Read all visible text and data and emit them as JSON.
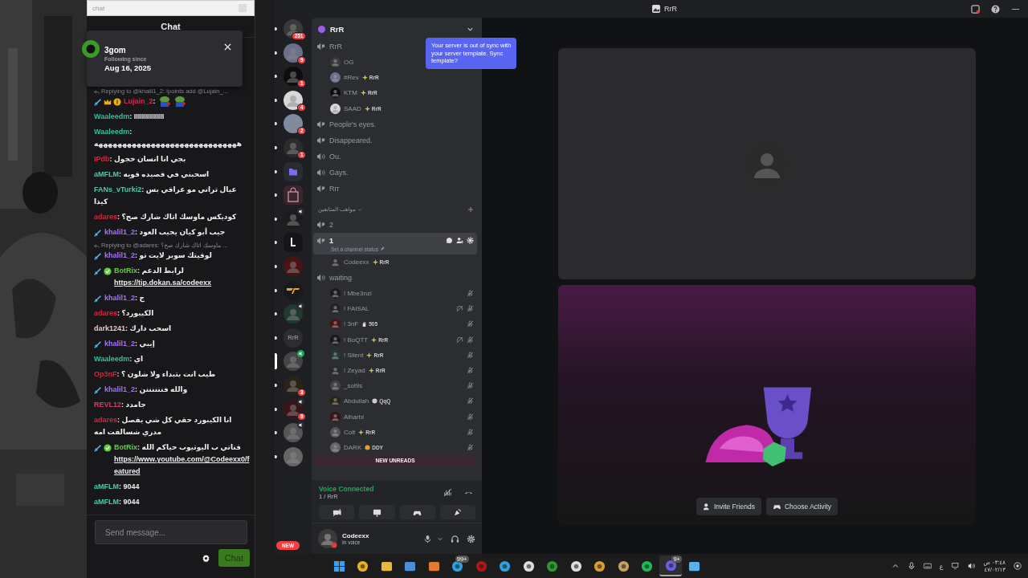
{
  "browser_field": {
    "placeholder": "chat"
  },
  "chat": {
    "title": "Chat",
    "follow_card": {
      "name": "3gom",
      "label": "Following since",
      "date": "Aug 16, 2025"
    },
    "messages": [
      {
        "reply": "Replying to @khalil1_2: !points add @Lujain_...",
        "badges": [
          {
            "kind": "sword"
          },
          {
            "kind": "crown"
          },
          {
            "kind": "coin"
          }
        ],
        "user": "Lujain_2",
        "color": "#d8284c",
        "text": ":",
        "emotes": [
          {
            "kind": "frog"
          },
          {
            "kind": "frog"
          }
        ]
      },
      {
        "user": "Waaleedm",
        "color": "#3bbf9a",
        "text": ": IIIIIIIIIIIIIII"
      },
      {
        "user": "Waaleedm",
        "color": "#3bbf9a",
        "text": ": ههههههههههههههههههههههههههههههه"
      },
      {
        "user": "IPdb",
        "color": "#d0283e",
        "text": ": بجي انا انسان خجول"
      },
      {
        "user": "aMFLM",
        "color": "#4ec9a6",
        "text": ": اسحبني في قصيده قويه"
      },
      {
        "user": "FANs_vTurki2",
        "color": "#4ec9a6",
        "text": ": عيال تراني مو عراقي بس كيذا"
      },
      {
        "user": "adares",
        "color": "#d0283e",
        "text": ": كوديكس ماوسك اتاك شارك صح؟"
      },
      {
        "badges": [
          {
            "kind": "sword"
          }
        ],
        "user": "khalil1_2",
        "color": "#a970ff",
        "text": ": جيب أبو كيان يجيب العود"
      },
      {
        "reply": "Replying to @adares: ماوسك اتاك شارك صح؟ ...",
        "badges": [
          {
            "kind": "sword"
          }
        ],
        "user": "khalil1_2",
        "color": "#a970ff",
        "text": ": لوقيتك سوبر لايت تو"
      },
      {
        "badges": [
          {
            "kind": "sword"
          },
          {
            "kind": "verified"
          }
        ],
        "user": "BotRix",
        "color": "#5ed23a",
        "text": ": لرابط الدعم ",
        "link": "https://tip.dokan.sa/codeexx"
      },
      {
        "badges": [
          {
            "kind": "sword"
          }
        ],
        "user": "khalil1_2",
        "color": "#a970ff",
        "text": ": ج"
      },
      {
        "user": "adares",
        "color": "#d0283e",
        "text": ": الكيبورد؟"
      },
      {
        "user": "dark1241",
        "color": "#e8c6cf",
        "text": ": اسحب دارك"
      },
      {
        "badges": [
          {
            "kind": "sword"
          }
        ],
        "user": "khalil1_2",
        "color": "#a970ff",
        "text": ": إيبي"
      },
      {
        "user": "Waaleedm",
        "color": "#3bbf9a",
        "text": ": اي"
      },
      {
        "user": "Op3nF",
        "color": "#d0283e",
        "text": ": طيب انت بتبداء ولا شلون ؟"
      },
      {
        "badges": [
          {
            "kind": "sword"
          }
        ],
        "user": "khalil1_2",
        "color": "#a970ff",
        "text": ": والله فننننننن"
      },
      {
        "user": "REVL12",
        "color": "#cf3f6a",
        "text": ": جامدد"
      },
      {
        "user": "adares",
        "color": "#d0283e",
        "text": ": انا الكيبورد حقي كل شي يفصل مدري شسالفت امه"
      },
      {
        "badges": [
          {
            "kind": "sword"
          },
          {
            "kind": "verified"
          }
        ],
        "user": "BotRix",
        "color": "#5ed23a",
        "text": ": قناتي ب اليوتيوب حياكم الله ",
        "link": "https://www.youtube.com/@Codeexx0/featured"
      },
      {
        "user": "aMFLM",
        "color": "#4ec9a6",
        "text": ": 9044"
      },
      {
        "user": "aMFLM",
        "color": "#4ec9a6",
        "text": ": 9044"
      }
    ],
    "input": {
      "placeholder": "Send message..."
    },
    "send_button": "Chat"
  },
  "title_bar": {
    "title": "RrR"
  },
  "rail": [
    {
      "kind": "avatar",
      "badge": "251",
      "speaker": false,
      "selected": false
    },
    {
      "kind": "avatar",
      "badge": "9",
      "speaker": false,
      "selected": false
    },
    {
      "kind": "avatar",
      "badge": "1",
      "speaker": false,
      "selected": false
    },
    {
      "kind": "avatar",
      "badge": "4",
      "speaker": false,
      "selected": false
    },
    {
      "kind": "avatar",
      "badge": "2",
      "speaker": false,
      "selected": false
    },
    {
      "kind": "avatar",
      "badge": "1",
      "speaker": false,
      "selected": false
    },
    {
      "kind": "folder",
      "speaker": false,
      "selected": false
    },
    {
      "kind": "bag",
      "speaker": false,
      "selected": false
    },
    {
      "kind": "avatar",
      "speaker": true,
      "selected": false
    },
    {
      "kind": "phone",
      "speaker": false,
      "selected": false
    },
    {
      "kind": "avatar",
      "speaker": false,
      "selected": false
    },
    {
      "kind": "logo",
      "speaker": false,
      "selected": false
    },
    {
      "kind": "avatar",
      "speaker": true,
      "selected": false
    },
    {
      "kind": "text",
      "label": "RrR",
      "speaker": false,
      "selected": false
    },
    {
      "kind": "avatar",
      "speaker": true,
      "selected": true
    },
    {
      "kind": "avatar",
      "badge": "3",
      "speaker": false,
      "selected": false
    },
    {
      "kind": "avatar",
      "badge": "9",
      "speaker": true,
      "selected": false
    },
    {
      "kind": "avatar",
      "speaker": true,
      "selected": false
    },
    {
      "kind": "avatar",
      "speaker": false,
      "selected": false
    }
  ],
  "new_pill": "NEW",
  "server": {
    "name": "RrR"
  },
  "tooltip": "Your server is out of sync with your server template. Sync template?",
  "channels": [
    {
      "kind": "stage",
      "name": "RrR",
      "selected": false,
      "members": [
        {
          "name": "OG",
          "muted": false,
          "deafened": false
        },
        {
          "name": "#Rev",
          "tag": {
            "kind": "diamond",
            "text": "RrR"
          },
          "muted": false,
          "deafened": false
        },
        {
          "name": "KTM",
          "tag": {
            "kind": "diamond",
            "text": "RrR"
          },
          "muted": false,
          "deafened": false
        },
        {
          "name": "SAAD",
          "tag": {
            "kind": "diamond",
            "text": "RrR"
          },
          "muted": false,
          "deafened": false
        }
      ]
    },
    {
      "kind": "stage",
      "name": "People's eyes.",
      "selected": false
    },
    {
      "kind": "stage",
      "name": "Disappeared.",
      "selected": false
    },
    {
      "kind": "voice",
      "name": "Ou.",
      "selected": false
    },
    {
      "kind": "voice",
      "name": "Gays.",
      "selected": false
    },
    {
      "kind": "stage",
      "name": "Rrr",
      "selected": false
    },
    {
      "kind": "category",
      "name": "مواهب المتابعين"
    },
    {
      "kind": "stage",
      "name": "2",
      "selected": false
    },
    {
      "kind": "stage",
      "name": "1",
      "selected": true,
      "status": "Set a channel status",
      "members": [
        {
          "name": "Codeexx",
          "tag": {
            "kind": "diamond",
            "text": "RrR"
          },
          "muted": false,
          "deafened": false
        }
      ]
    },
    {
      "kind": "voice",
      "name": "waiting",
      "selected": false,
      "members": [
        {
          "name": "! Mbe3nzi",
          "muted": true,
          "deafened": false
        },
        {
          "name": "! FAISAL",
          "muted": true,
          "deafened": true
        },
        {
          "name": "! 3nF",
          "tag": {
            "kind": "hand",
            "text": "505"
          },
          "muted": true,
          "deafened": false
        },
        {
          "name": "! BoQTT",
          "tag": {
            "kind": "diamond",
            "text": "RrR"
          },
          "muted": true,
          "deafened": true
        },
        {
          "name": "! Silent",
          "tag": {
            "kind": "diamond",
            "text": "RrR"
          },
          "muted": true,
          "deafened": false
        },
        {
          "name": "! Zeyad",
          "tag": {
            "kind": "diamond",
            "text": "RrR"
          },
          "muted": true,
          "deafened": false
        },
        {
          "name": "_sol9s",
          "muted": true,
          "deafened": false
        },
        {
          "name": "Abdullah",
          "tag": {
            "kind": "skull",
            "text": "QqQ"
          },
          "muted": true,
          "deafened": false
        },
        {
          "name": "Alharbi",
          "muted": true,
          "deafened": false
        },
        {
          "name": "Colt",
          "tag": {
            "kind": "diamond",
            "text": "RrR"
          },
          "muted": true,
          "deafened": false
        },
        {
          "name": "DARK",
          "tag": {
            "kind": "face",
            "text": "DDY"
          },
          "muted": true,
          "deafened": false
        }
      ]
    }
  ],
  "new_unreads": "NEW UNREADS",
  "voice": {
    "status": "Voice Connected",
    "channel": "1 / RrR"
  },
  "user": {
    "name": "Codeexx",
    "status": "In voice"
  },
  "main": {
    "invite": "Invite Friends",
    "activity": "Choose Activity"
  },
  "taskbar": {
    "apps": [
      {
        "kind": "windows",
        "selected": false
      },
      {
        "kind": "chrome",
        "selected": false
      },
      {
        "kind": "files",
        "selected": false
      },
      {
        "kind": "store",
        "selected": false
      },
      {
        "kind": "orange",
        "selected": false
      },
      {
        "kind": "telegram",
        "badge": "99+",
        "selected": false
      },
      {
        "kind": "red",
        "selected": false
      },
      {
        "kind": "telegram",
        "selected": false
      },
      {
        "kind": "steel",
        "selected": false
      },
      {
        "kind": "xbox",
        "selected": false
      },
      {
        "kind": "ring",
        "selected": false
      },
      {
        "kind": "gold",
        "selected": false
      },
      {
        "kind": "lamp",
        "selected": false
      },
      {
        "kind": "spotify",
        "selected": false
      },
      {
        "kind": "discord",
        "badge": "9+",
        "selected": true
      },
      {
        "kind": "notepad",
        "selected": false
      }
    ],
    "lang": "ع",
    "time": "٠٣:٤٨ ص",
    "date": "٤٧/٠٢/١٣"
  }
}
